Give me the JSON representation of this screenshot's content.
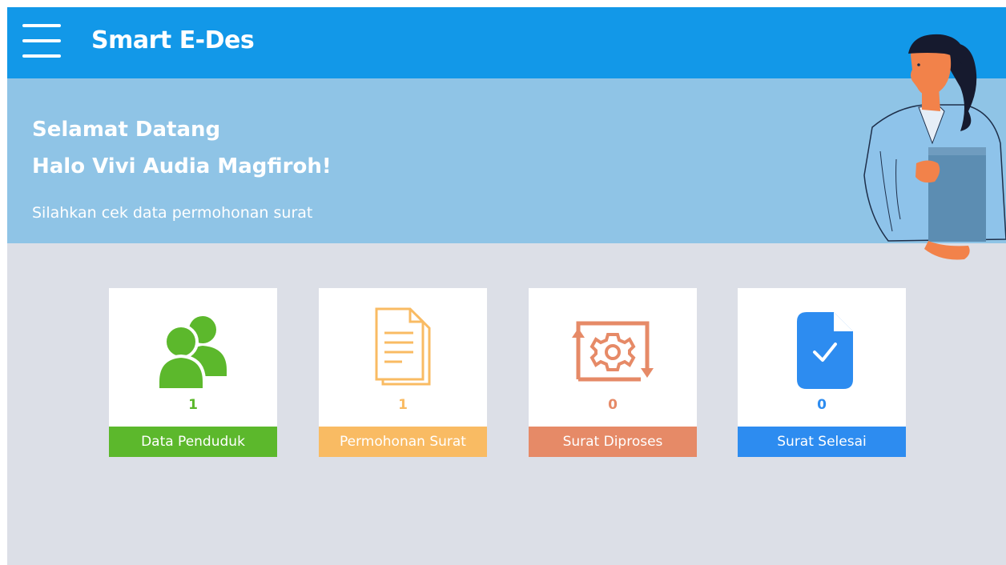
{
  "header": {
    "title": "Smart E-Des",
    "menu_icon": "hamburger-menu-icon",
    "color": "#1298e8"
  },
  "banner": {
    "greeting": "Selamat Datang",
    "user_greeting": "Halo Vivi Audia Magfiroh!",
    "subtitle": "Silahkan cek data permohonan surat",
    "color": "#8fc4e6"
  },
  "cards": [
    {
      "label": "Data Penduduk",
      "count": "1",
      "icon": "users-icon",
      "color": "#5cb82c"
    },
    {
      "label": "Permohonan Surat",
      "count": "1",
      "icon": "document-icon",
      "color": "#f9bb63"
    },
    {
      "label": "Surat Diproses",
      "count": "0",
      "icon": "gear-process-icon",
      "color": "#e68a67"
    },
    {
      "label": "Surat Selesai",
      "count": "0",
      "icon": "document-check-icon",
      "color": "#2d8cf0"
    }
  ]
}
